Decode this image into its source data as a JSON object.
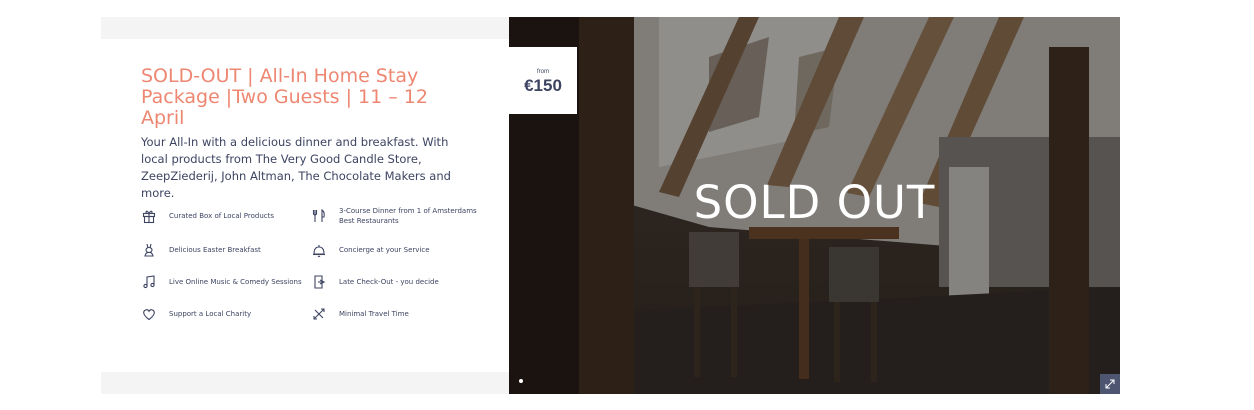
{
  "package": {
    "title": "SOLD-OUT | All-In Home Stay Package |Two Guests | 11 – 12 April",
    "description": "Your All-In with a delicious dinner and breakfast. With local products from The Very Good Candle Store, ZeepZiederij, John Altman, The Chocolate Makers and more.",
    "features": [
      {
        "label": "Curated Box of Local Products",
        "icon": "gift-box-icon"
      },
      {
        "label": "3-Course Dinner from 1 of Amsterdams Best Restaurants",
        "icon": "cutlery-icon"
      },
      {
        "label": "Delicious Easter Breakfast",
        "icon": "easter-rabbit-icon"
      },
      {
        "label": "Concierge at your Service",
        "icon": "concierge-bell-icon"
      },
      {
        "label": "Live Online Music & Comedy Sessions",
        "icon": "music-note-icon"
      },
      {
        "label": "Late Check-Out - you decide",
        "icon": "door-exit-icon"
      },
      {
        "label": "Support a Local Charity",
        "icon": "heart-icon"
      },
      {
        "label": "Minimal Travel Time",
        "icon": "no-travel-icon"
      }
    ]
  },
  "price": {
    "from_label": "from",
    "value": "€150"
  },
  "image": {
    "overlay_text": "SOLD OUT"
  },
  "colors": {
    "title": "#ee8772",
    "text": "#3d4462",
    "panel_bg": "#f4f4f5"
  }
}
